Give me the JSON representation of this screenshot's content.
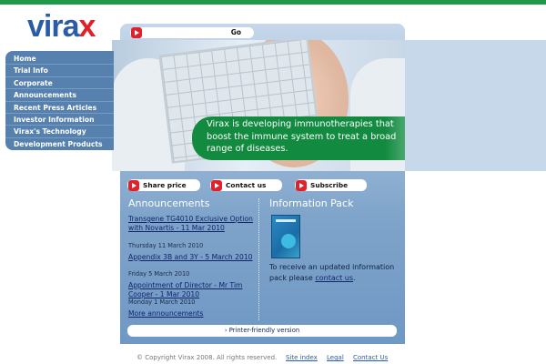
{
  "brand": {
    "logo_text_main": "vira",
    "logo_text_accent": "x",
    "green": "#1f9a4b",
    "blue": "#2b5da6",
    "red": "#e0202a"
  },
  "search": {
    "go_label": "Go",
    "icon": "arrow-right-icon"
  },
  "nav": {
    "items": [
      {
        "label": "Home"
      },
      {
        "label": "Trial Info"
      },
      {
        "label": "Corporate"
      },
      {
        "label": "Announcements"
      },
      {
        "label": "Recent Press Articles"
      },
      {
        "label": "Investor Information"
      },
      {
        "label": "Virax's Technology"
      },
      {
        "label": "Development Products"
      }
    ]
  },
  "hero": {
    "text": "Virax is developing immunotherapies that boost the immune system to treat a broad range of diseases."
  },
  "actions": {
    "share_price": "Share price",
    "contact_us": "Contact us",
    "subscribe": "Subscribe"
  },
  "announcements": {
    "heading": "Announcements",
    "items": [
      {
        "title": "Transgene TG4010 Exclusive Option with Novartis - 11 Mar 2010",
        "date": "Thursday 11 March 2010"
      },
      {
        "title": "Appendix 3B and 3Y - 5 March 2010",
        "date": "Friday 5 March 2010"
      },
      {
        "title": "Appointment of Director - Mr Tim Cooper - 1 Mar 2010",
        "date": "Monday 1 March 2010"
      }
    ],
    "more": "More announcements"
  },
  "info_pack": {
    "heading": "Information Pack",
    "text_before": "To receive an updated information pack please",
    "link": "contact us",
    "text_after": "."
  },
  "printer": {
    "label": "› Printer-friendly version"
  },
  "footer": {
    "copyright": "© Copyright Virax 2008. All rights reserved.",
    "site_index": "Site index",
    "legal": "Legal",
    "contact": "Contact Us"
  }
}
